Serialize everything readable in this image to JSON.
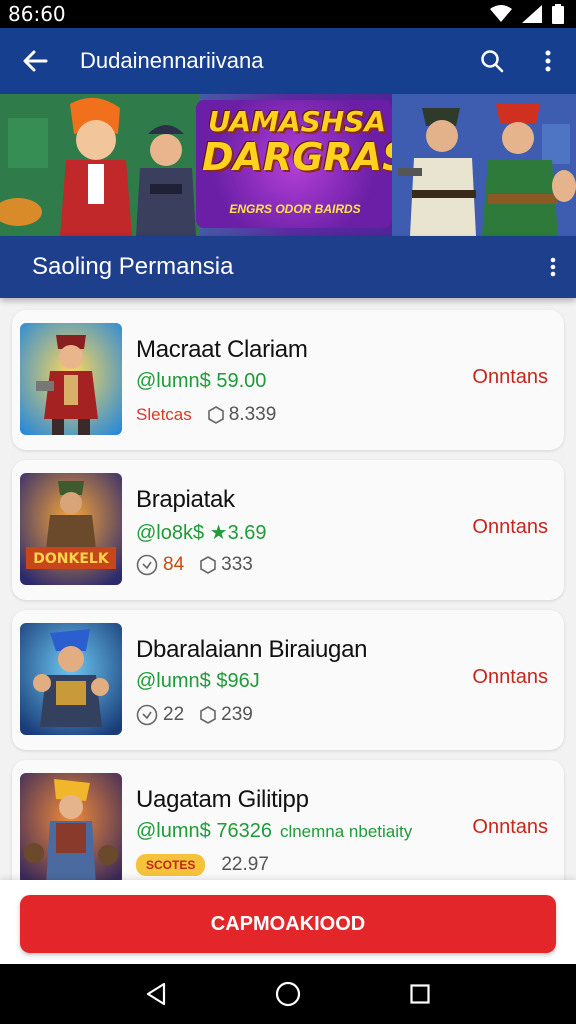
{
  "status_bar": {
    "time": "86:60"
  },
  "app_bar": {
    "title": "Dudainennariivana"
  },
  "banner": {
    "headline_line1": "UAMASHSA",
    "headline_line2": "DARGRASI!",
    "subtext": "ENGRS ODOR BAIRDS"
  },
  "section": {
    "title": "Saoling Permansia"
  },
  "games": [
    {
      "name": "Macraat Clariam",
      "price": "@lumn$ 59.00",
      "note": "",
      "meta1": "Sletcas",
      "meta2": "8.339",
      "action": "Onntans"
    },
    {
      "name": "Brapiatak",
      "price": "@lo8k$ ★3.69",
      "note": "",
      "meta1": "84",
      "meta2": "333",
      "action": "Onntans"
    },
    {
      "name": "Dbaralaiann Biraiugan",
      "price": "@lumn$ $96J",
      "note": "",
      "meta1": "22",
      "meta2": "239",
      "action": "Onntans"
    },
    {
      "name": "Uagatam Gilitipp",
      "price": "@lumn$ 76326",
      "note": "clnemna nbetiaity",
      "meta1": "",
      "meta2": "22.97",
      "action": "Onntans"
    }
  ],
  "bottom": {
    "button_label": "CAPMOAKIOOD"
  },
  "icons": {
    "back": "arrow-left-icon",
    "search": "search-icon",
    "more": "more-vertical-icon",
    "nav_back": "triangle-back-icon",
    "nav_home": "circle-home-icon",
    "nav_recents": "square-recents-icon"
  },
  "colors": {
    "app_bar": "#173f8f",
    "section_bar": "#1e3f8c",
    "price_green": "#1f9b3a",
    "action_red": "#c8261d",
    "button_red": "#e3262a"
  }
}
